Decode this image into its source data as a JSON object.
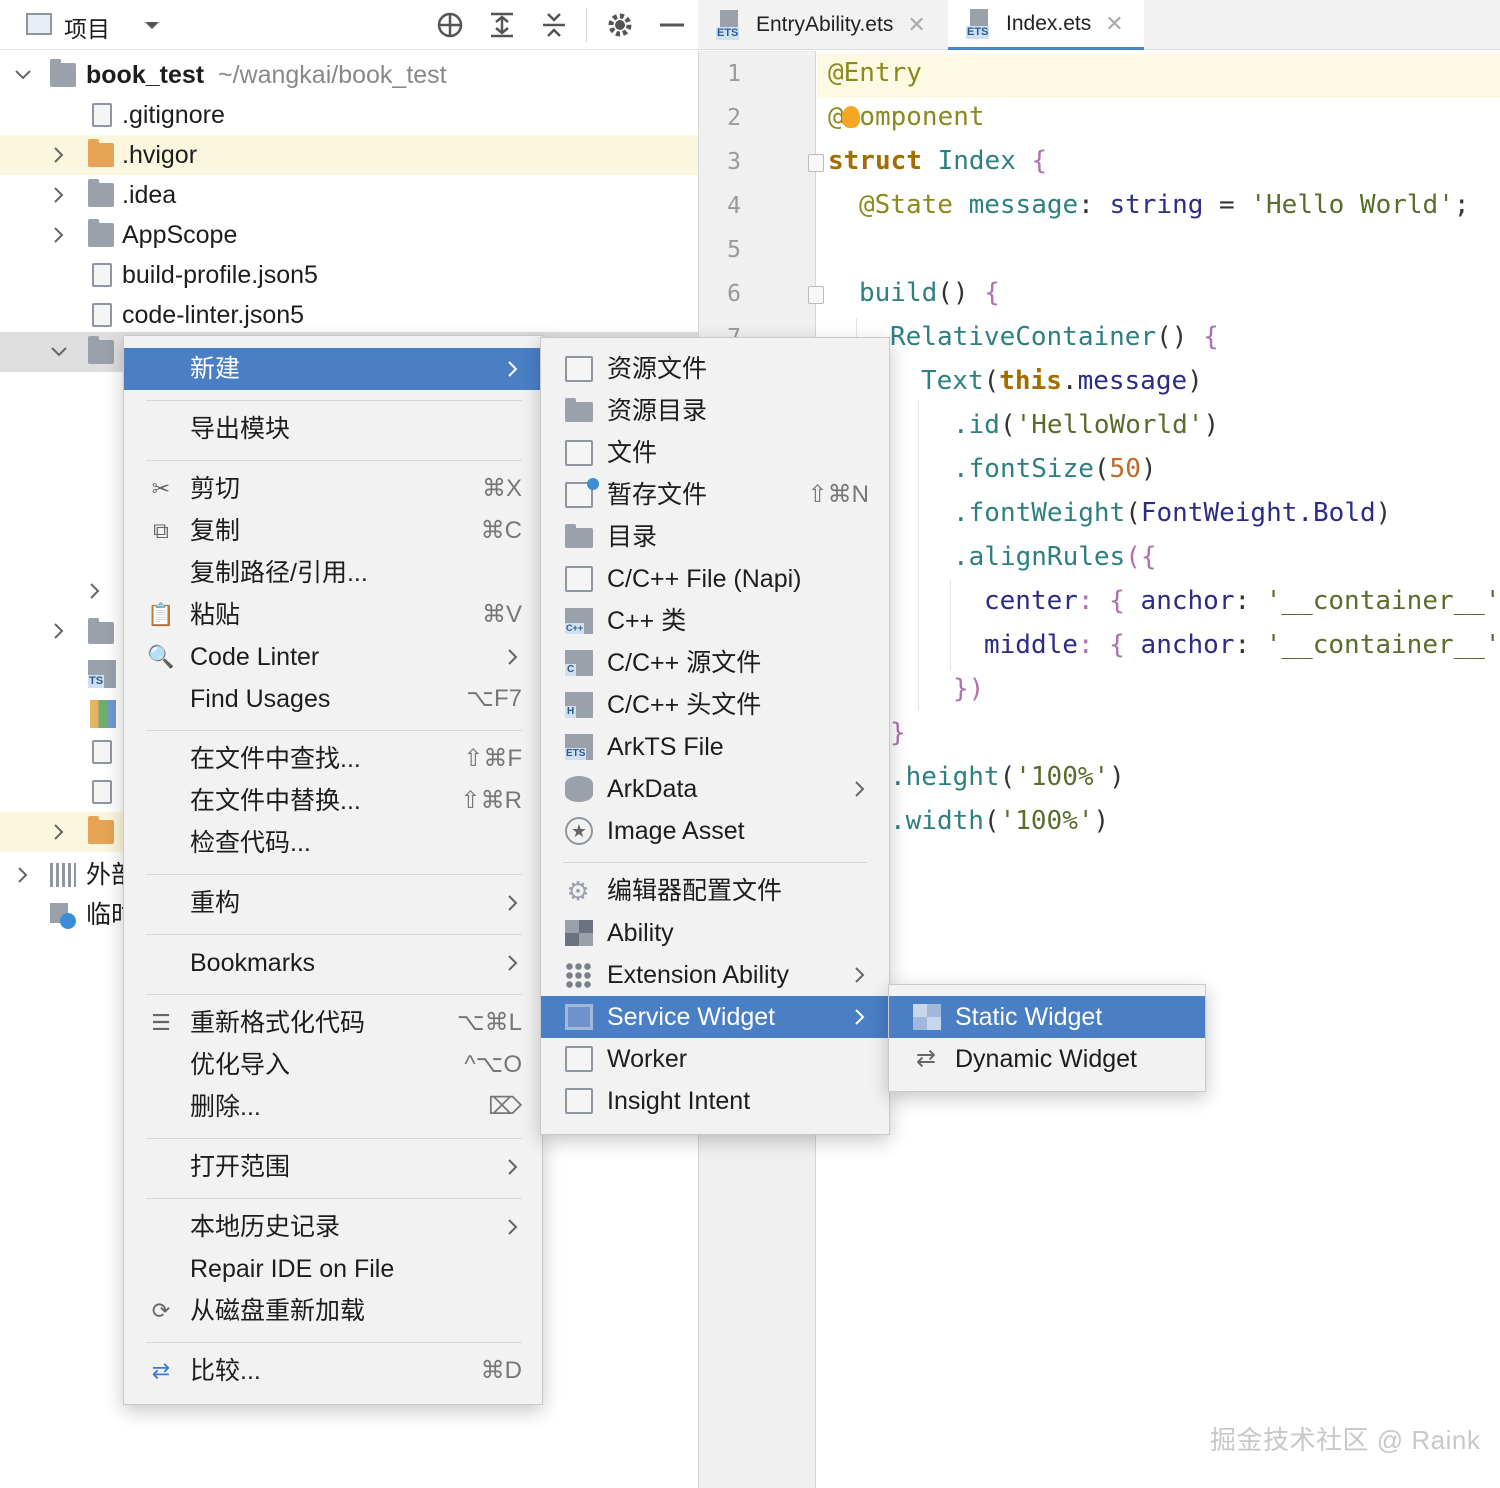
{
  "project_panel": {
    "title": "项目",
    "root": {
      "name": "book_test",
      "path": "~/wangkai/book_test"
    },
    "items": [
      ".gitignore",
      ".hvigor",
      ".idea",
      "AppScope",
      "build-profile.json5",
      "code-linter.json5"
    ],
    "partial_items": [
      "外部",
      "临时"
    ]
  },
  "editor": {
    "tabs": [
      {
        "label": "EntryAbility.ets",
        "badge": "ETS"
      },
      {
        "label": "Index.ets",
        "badge": "ETS"
      }
    ],
    "line_numbers": [
      "1",
      "2",
      "3",
      "4",
      "5",
      "6",
      "7"
    ],
    "code": {
      "l1": "@Entry",
      "l2_a": "@",
      "l2_b": "omponent",
      "l3_kw": "struct",
      "l3_id": " Index ",
      "l3_br": "{",
      "l4_ann": "@State",
      "l4_id": " message",
      "l4_p": ": ",
      "l4_type": "string",
      "l4_eq": " = ",
      "l4_str": "'Hello World'",
      "l4_end": ";",
      "l6_fn": "build",
      "l6_p": "() ",
      "l6_br": "{",
      "l7_fn": "RelativeContainer",
      "l7_p": "() ",
      "l7_br": "{",
      "l8_fn": "Text",
      "l8_a": "(",
      "l8_kw": "this",
      "l8_b": ".",
      "l8_id": "message",
      "l8_c": ")",
      "l9_fn": ".id",
      "l9_a": "(",
      "l9_str": "'HelloWorld'",
      "l9_b": ")",
      "l10_fn": ".fontSize",
      "l10_a": "(",
      "l10_num": "50",
      "l10_b": ")",
      "l11_fn": ".fontWeight",
      "l11_a": "(",
      "l11_id": "FontWeight.Bold",
      "l11_b": ")",
      "l12_fn": ".alignRules",
      "l12_a": "({",
      "l13_id": "center",
      "l13_p": ": { ",
      "l13_id2": "anchor",
      "l13_p2": ": ",
      "l13_str": "'__container__'",
      "l14_id": "middle",
      "l14_p": ": { ",
      "l14_id2": "anchor",
      "l14_p2": ": ",
      "l14_str": "'__container__'",
      "l15": "})",
      "l16": "}",
      "l17_fn": ".height",
      "l17_a": "(",
      "l17_str": "'100%'",
      "l17_b": ")",
      "l18_fn": ".width",
      "l18_a": "(",
      "l18_str": "'100%'",
      "l18_b": ")"
    }
  },
  "context_menu": {
    "items": [
      {
        "label": "新建",
        "submenu": true,
        "selected": true
      },
      {
        "label": "导出模块"
      },
      {
        "label": "剪切",
        "shortcut": "⌘X",
        "icon": "cut-icon"
      },
      {
        "label": "复制",
        "shortcut": "⌘C",
        "icon": "copy-icon"
      },
      {
        "label": "复制路径/引用..."
      },
      {
        "label": "粘贴",
        "shortcut": "⌘V",
        "icon": "paste-icon"
      },
      {
        "label": "Code Linter",
        "submenu": true,
        "icon": "linter-icon"
      },
      {
        "label": "Find Usages",
        "shortcut": "⌥F7"
      },
      {
        "label": "在文件中查找...",
        "shortcut": "⇧⌘F"
      },
      {
        "label": "在文件中替换...",
        "shortcut": "⇧⌘R"
      },
      {
        "label": "检查代码..."
      },
      {
        "label": "重构",
        "submenu": true
      },
      {
        "label": "Bookmarks",
        "submenu": true
      },
      {
        "label": "重新格式化代码",
        "shortcut": "⌥⌘L",
        "icon": "reformat-icon"
      },
      {
        "label": "优化导入",
        "shortcut": "^⌥O"
      },
      {
        "label": "删除...",
        "shortcut": "⌦"
      },
      {
        "label": "打开范围",
        "submenu": true
      },
      {
        "label": "本地历史记录",
        "submenu": true
      },
      {
        "label": "Repair IDE on File"
      },
      {
        "label": "从磁盘重新加载",
        "icon": "reload-icon"
      },
      {
        "label": "比较...",
        "shortcut": "⌘D",
        "icon": "compare-icon"
      }
    ]
  },
  "new_submenu": {
    "items": [
      {
        "label": "资源文件",
        "icon": "resource-file-icon"
      },
      {
        "label": "资源目录",
        "icon": "folder-icon"
      },
      {
        "label": "文件",
        "icon": "file-icon"
      },
      {
        "label": "暂存文件",
        "shortcut": "⇧⌘N",
        "icon": "scratch-file-icon"
      },
      {
        "label": "目录",
        "icon": "folder-icon"
      },
      {
        "label": "C/C++ File (Napi)",
        "icon": "napi-file-icon"
      },
      {
        "label": "C++ 类",
        "icon": "cpp-class-icon",
        "badge": "C++"
      },
      {
        "label": "C/C++ 源文件",
        "icon": "c-source-icon",
        "badge": "C"
      },
      {
        "label": "C/C++ 头文件",
        "icon": "c-header-icon",
        "badge": "H"
      },
      {
        "label": "ArkTS File",
        "icon": "arkts-file-icon",
        "badge": "ETS"
      },
      {
        "label": "ArkData",
        "submenu": true,
        "icon": "database-icon"
      },
      {
        "label": "Image Asset",
        "icon": "image-asset-icon"
      },
      {
        "label": "编辑器配置文件",
        "icon": "gear-icon"
      },
      {
        "label": "Ability",
        "icon": "ability-icon"
      },
      {
        "label": "Extension Ability",
        "submenu": true,
        "icon": "extension-icon"
      },
      {
        "label": "Service Widget",
        "submenu": true,
        "selected": true,
        "icon": "widget-icon"
      },
      {
        "label": "Worker",
        "icon": "worker-icon"
      },
      {
        "label": "Insight Intent",
        "icon": "intent-icon"
      }
    ]
  },
  "widget_submenu": {
    "items": [
      {
        "label": "Static Widget",
        "selected": true,
        "icon": "static-widget-icon"
      },
      {
        "label": "Dynamic Widget",
        "icon": "dynamic-widget-icon"
      }
    ]
  },
  "watermark": "掘金技术社区 @ Raink",
  "colors": {
    "selection": "#4a7fc6",
    "menu_bg": "#f2f2f2",
    "highlight_row": "#fbf7de"
  }
}
